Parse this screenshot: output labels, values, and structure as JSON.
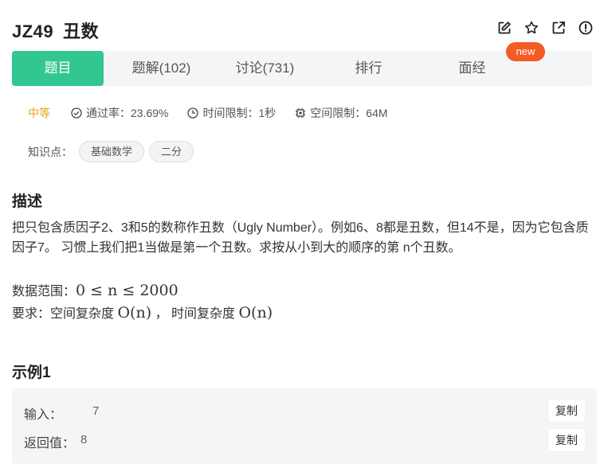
{
  "header": {
    "code": "JZ49",
    "title": "丑数",
    "icons": [
      "edit-icon",
      "star-icon",
      "external-link-icon",
      "info-icon"
    ]
  },
  "tabs": {
    "new_badge": "new",
    "items": [
      {
        "label": "题目",
        "active": true
      },
      {
        "label": "题解(102)",
        "active": false
      },
      {
        "label": "讨论(731)",
        "active": false
      },
      {
        "label": "排行",
        "active": false
      },
      {
        "label": "面经",
        "active": false
      }
    ]
  },
  "meta": {
    "difficulty": "中等",
    "pass_rate": "通过率：23.69%",
    "time_limit": "时间限制：1秒",
    "space_limit": "空间限制：64M"
  },
  "tags": {
    "label": "知识点：",
    "items": [
      "基础数学",
      "二分"
    ]
  },
  "description": {
    "heading": "描述",
    "text": "把只包含质因子2、3和5的数称作丑数（Ugly Number）。例如6、8都是丑数，但14不是，因为它包含质因子7。 习惯上我们把1当做是第一个丑数。求按从小到大的顺序的第 n个丑数。",
    "range_label": "数据范围：",
    "range_math": "0 ≤ n ≤ 2000",
    "req_label": "要求：空间复杂度",
    "req_space": "O(n)",
    "req_sep": "， 时间复杂度",
    "req_time": "O(n)"
  },
  "example": {
    "heading": "示例1",
    "input_label": "输入：",
    "input_value": "7",
    "output_label": "返回值：",
    "output_value": "8",
    "copy_label": "复制"
  },
  "colors": {
    "accent": "#32c790",
    "badge": "#f45b25",
    "difficulty": "#e8a316"
  }
}
